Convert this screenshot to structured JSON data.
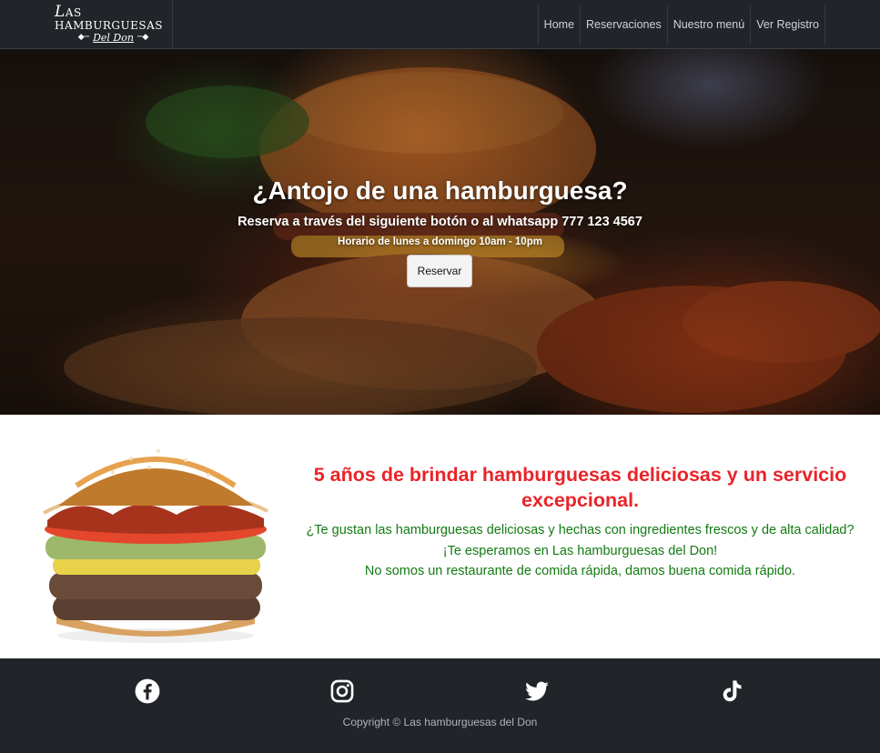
{
  "brand": {
    "line1_big": "L",
    "line1_rest": "as hamburguesas",
    "line2": "Del Don"
  },
  "nav": {
    "items": [
      "Home",
      "Reservaciones",
      "Nuestro menú",
      "Ver Registro"
    ]
  },
  "hero": {
    "title": "¿Antojo de una hamburguesa?",
    "subtitle": "Reserva a través del siguiente botón o al whatsapp 777 123 4567",
    "hours": "Horario de lunes a domingo 10am - 10pm",
    "button": "Reservar"
  },
  "about": {
    "heading": "5 años de brindar hamburguesas deliciosas y un servicio excepcional.",
    "lines": [
      "¿Te gustan las hamburguesas deliciosas y hechas con ingredientes frescos y de alta calidad?",
      "¡Te esperamos en Las hamburguesas del Don!",
      "No somos un restaurante de comida rápida, damos buena comida rápido."
    ]
  },
  "footer": {
    "icons": [
      "facebook-icon",
      "instagram-icon",
      "twitter-icon",
      "tiktok-icon"
    ],
    "copyright": "Copyright © Las hamburguesas del Don"
  },
  "colors": {
    "navbar": "#212529",
    "heading_red": "#e8242a",
    "text_green": "#127a12"
  }
}
